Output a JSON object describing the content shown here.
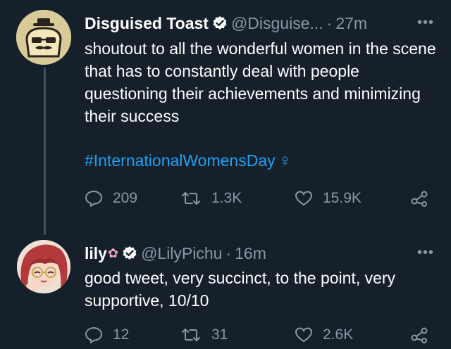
{
  "tweets": [
    {
      "author_name": "Disguised Toast",
      "handle": "@Disguise...",
      "separator": "·",
      "time": "27m",
      "more": "•••",
      "text": "shoutout to all the wonderful women in the scene that has to constantly deal with people questioning their achievements and minimizing their success",
      "hashtag": "#InternationalWomensDay",
      "hashtag_emoji": "♀",
      "replies": "209",
      "retweets": "1.3K",
      "likes": "15.9K"
    },
    {
      "author_name": "lily",
      "name_emoji": "✿",
      "handle": "@LilyPichu",
      "separator": "·",
      "time": "16m",
      "more": "•••",
      "text": "good tweet, very succinct, to the point, very supportive, 10/10",
      "replies": "12",
      "retweets": "31",
      "likes": "2.6K"
    }
  ],
  "colors": {
    "background": "#15202b",
    "secondary_text": "#8899a6",
    "link": "#1da1f2",
    "thread_line": "#3d5466"
  }
}
